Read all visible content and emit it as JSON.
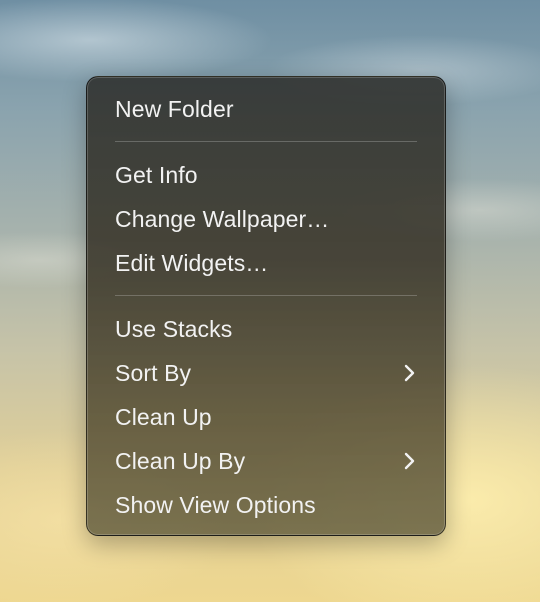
{
  "context_menu": {
    "groups": [
      {
        "items": [
          {
            "label": "New Folder",
            "has_submenu": false
          }
        ]
      },
      {
        "items": [
          {
            "label": "Get Info",
            "has_submenu": false
          },
          {
            "label": "Change Wallpaper…",
            "has_submenu": false
          },
          {
            "label": "Edit Widgets…",
            "has_submenu": false
          }
        ]
      },
      {
        "items": [
          {
            "label": "Use Stacks",
            "has_submenu": false
          },
          {
            "label": "Sort By",
            "has_submenu": true,
            "icon": "chevron-right-icon"
          },
          {
            "label": "Clean Up",
            "has_submenu": false
          },
          {
            "label": "Clean Up By",
            "has_submenu": true,
            "icon": "chevron-right-icon"
          },
          {
            "label": "Show View Options",
            "has_submenu": false
          }
        ]
      }
    ]
  },
  "colors": {
    "menu_text": "#f2f2f2",
    "separator": "#6b6a62",
    "sky_top": "#6f8fa3",
    "sky_bottom": "#eed790"
  }
}
